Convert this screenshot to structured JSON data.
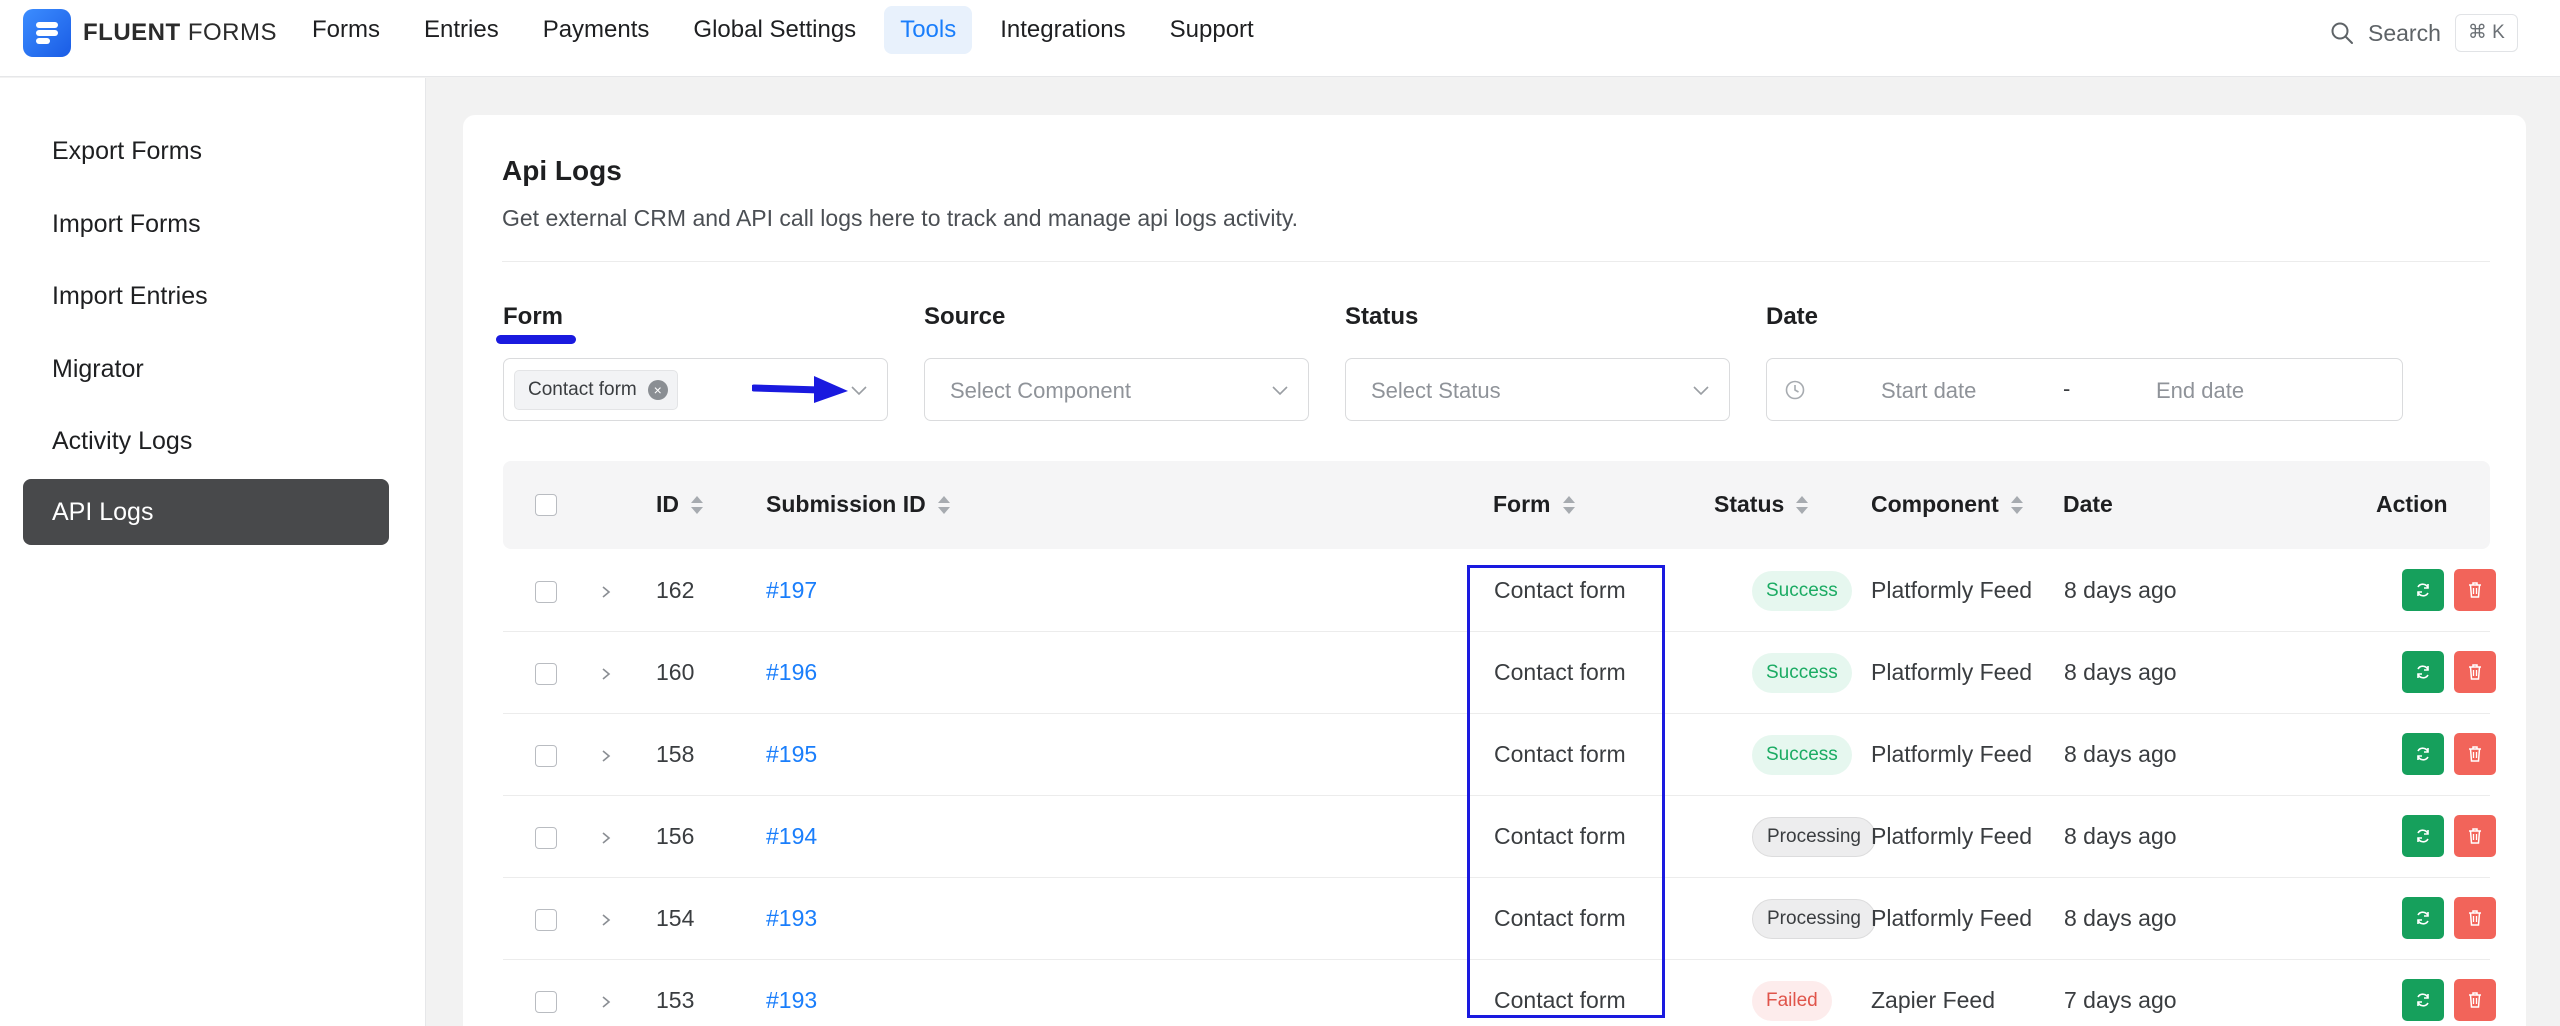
{
  "app": {
    "logo_bold": "FLUENT",
    "logo_light": "FORMS"
  },
  "nav": {
    "items": [
      {
        "label": "Forms"
      },
      {
        "label": "Entries"
      },
      {
        "label": "Payments"
      },
      {
        "label": "Global Settings"
      },
      {
        "label": "Tools",
        "active": true
      },
      {
        "label": "Integrations"
      },
      {
        "label": "Support"
      }
    ],
    "search_label": "Search",
    "shortcut": "⌘ K"
  },
  "sidebar": {
    "items": [
      {
        "label": "Export Forms"
      },
      {
        "label": "Import Forms"
      },
      {
        "label": "Import Entries"
      },
      {
        "label": "Migrator"
      },
      {
        "label": "Activity Logs"
      },
      {
        "label": "API Logs",
        "active": true
      }
    ]
  },
  "page": {
    "title": "Api Logs",
    "subtitle": "Get external CRM and API call logs here to track and manage api logs activity."
  },
  "filters": {
    "form": {
      "label": "Form",
      "selected_tag": "Contact form"
    },
    "source": {
      "label": "Source",
      "placeholder": "Select Component"
    },
    "status": {
      "label": "Status",
      "placeholder": "Select Status"
    },
    "date": {
      "label": "Date",
      "start_placeholder": "Start date",
      "separator": "-",
      "end_placeholder": "End date"
    }
  },
  "table": {
    "columns": {
      "id": "ID",
      "submission_id": "Submission ID",
      "form": "Form",
      "status": "Status",
      "component": "Component",
      "date": "Date",
      "action": "Action"
    },
    "rows": [
      {
        "id": "162",
        "submission": "#197",
        "form": "Contact form",
        "status": "Success",
        "status_type": "success",
        "component": "Platformly Feed",
        "date": "8 days ago"
      },
      {
        "id": "160",
        "submission": "#196",
        "form": "Contact form",
        "status": "Success",
        "status_type": "success",
        "component": "Platformly Feed",
        "date": "8 days ago"
      },
      {
        "id": "158",
        "submission": "#195",
        "form": "Contact form",
        "status": "Success",
        "status_type": "success",
        "component": "Platformly Feed",
        "date": "8 days ago"
      },
      {
        "id": "156",
        "submission": "#194",
        "form": "Contact form",
        "status": "Processing",
        "status_type": "processing",
        "component": "Platformly Feed",
        "date": "8 days ago"
      },
      {
        "id": "154",
        "submission": "#193",
        "form": "Contact form",
        "status": "Processing",
        "status_type": "processing",
        "component": "Platformly Feed",
        "date": "8 days ago"
      },
      {
        "id": "153",
        "submission": "#193",
        "form": "Contact form",
        "status": "Failed",
        "status_type": "failed",
        "component": "Zapier Feed",
        "date": "7 days ago"
      }
    ]
  },
  "colors": {
    "accent": "#1a7efb",
    "annotation": "#1a1adf",
    "success": "#1bab63",
    "failed": "#e0544a"
  }
}
